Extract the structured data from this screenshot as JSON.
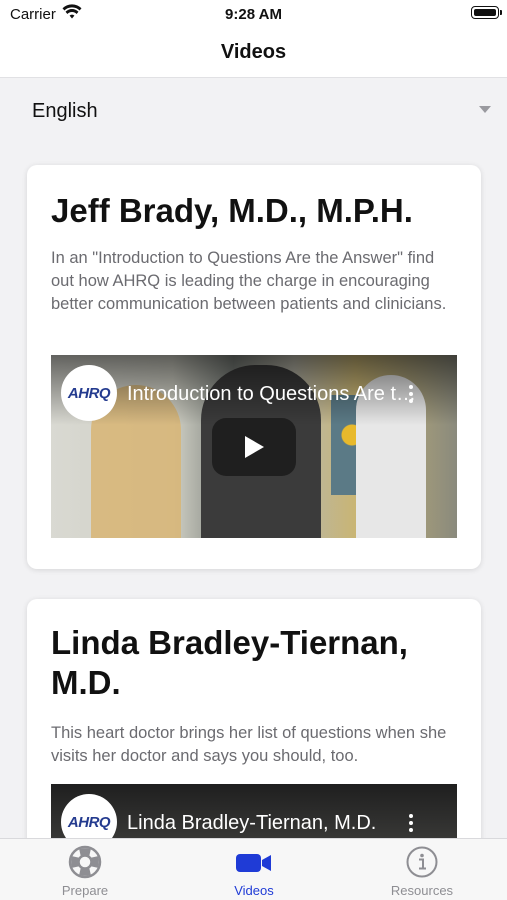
{
  "status_bar": {
    "carrier": "Carrier",
    "time": "9:28 AM"
  },
  "nav": {
    "title": "Videos"
  },
  "language_selector": {
    "value": "English"
  },
  "videos": [
    {
      "title": "Jeff Brady, M.D., M.P.H.",
      "description": "In an \"Introduction to Questions Are the Answer\" find out how AHRQ is leading the charge in encouraging better communication between patients and clinicians.",
      "video_title": "Introduction to Questions Are the Answer",
      "logo_text": "AHRQ"
    },
    {
      "title": "Linda Bradley-Tiernan, M.D.",
      "description": "This heart doctor brings her list of questions when she visits her doctor and says you should, too.",
      "video_title": "Linda Bradley-Tiernan, M.D.",
      "logo_text": "AHRQ"
    }
  ],
  "tabbar": {
    "items": [
      {
        "label": "Prepare",
        "icon": "lifebuoy-icon"
      },
      {
        "label": "Videos",
        "icon": "video-camera-icon",
        "active": true
      },
      {
        "label": "Resources",
        "icon": "info-icon"
      }
    ]
  },
  "colors": {
    "accent": "#1f3bd6",
    "inactive": "#8e8e93",
    "background": "#f2f2f4"
  }
}
